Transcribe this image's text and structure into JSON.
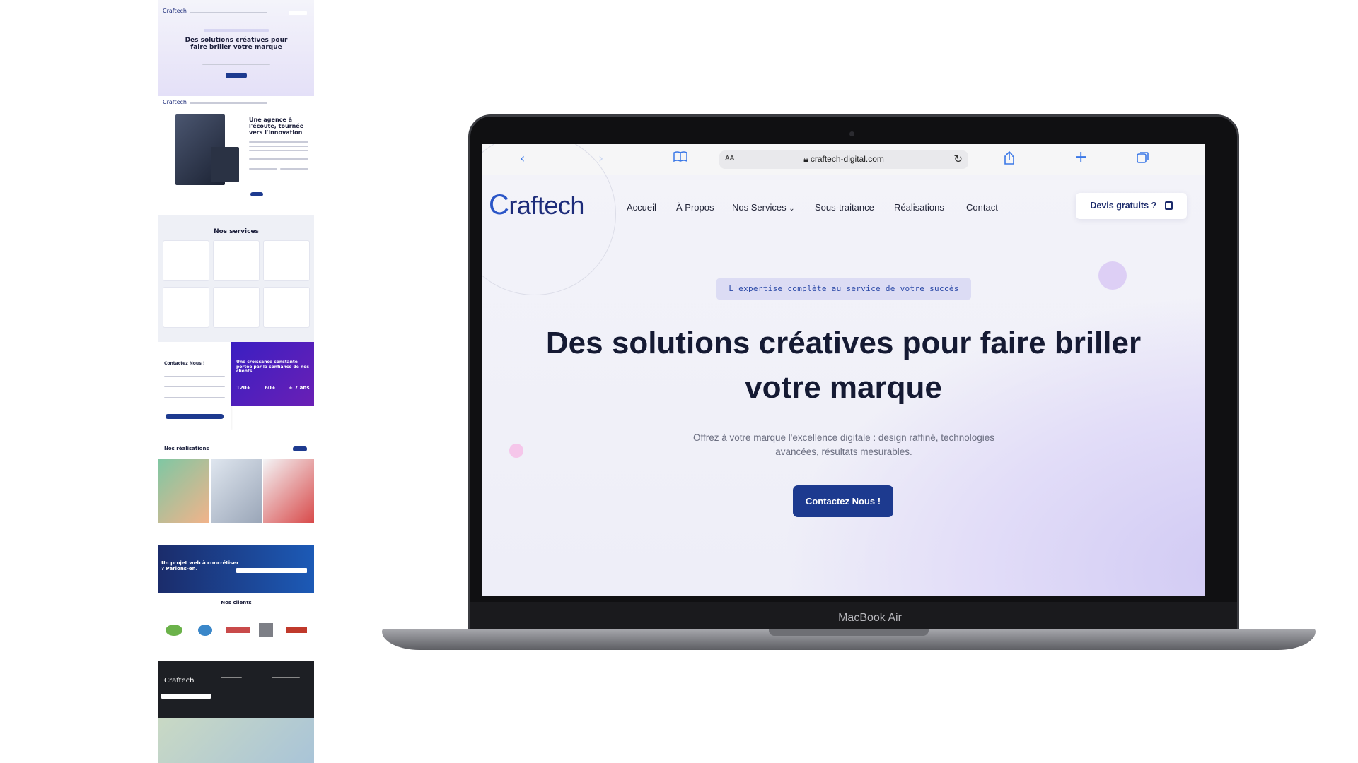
{
  "thumbnails": {
    "hero": {
      "logo": "Craftech",
      "title": "Des solutions créatives pour faire briller votre marque"
    },
    "about": {
      "logo": "Craftech",
      "title": "Une agence à l'écoute, tournée vers l'innovation"
    },
    "services": {
      "title": "Nos services"
    },
    "contact": {
      "title": "Contactez Nous !",
      "tagline": "Une croissance constante portée par la confiance de nos clients",
      "stats": [
        "120+",
        "60+",
        "+ 7 ans"
      ]
    },
    "realisations": {
      "title": "Nos réalisations"
    },
    "cta_banner": {
      "title": "Un projet web à concrétiser ? Parlons-en."
    },
    "clients": {
      "title": "Nos clients"
    },
    "footer": {
      "logo": "Craftech"
    }
  },
  "laptop": {
    "model_label": "MacBook Air"
  },
  "browser": {
    "address_aa": "AA",
    "url": "craftech-digital.com",
    "icons": [
      "back-icon",
      "forward-icon",
      "bookmarks-icon",
      "lock-icon",
      "reload-icon",
      "share-icon",
      "new-tab-icon",
      "tabs-icon"
    ]
  },
  "site": {
    "logo_initial": "C",
    "logo_rest": "raftech",
    "nav": [
      "Accueil",
      "À Propos",
      "Nos Services",
      "Sous-traitance",
      "Réalisations",
      "Contact"
    ],
    "quote_button": "Devis gratuits ?",
    "badge": "L'expertise complète au service de votre succès",
    "hero_title": "Des solutions créatives pour faire briller votre marque",
    "hero_subtitle": "Offrez à votre marque l'excellence digitale : design raffiné, technologies avancées, résultats mesurables.",
    "cta": "Contactez Nous !",
    "colors": {
      "primary": "#1d3a8f",
      "text": "#151a33",
      "accent": "#2c4aa8"
    }
  }
}
